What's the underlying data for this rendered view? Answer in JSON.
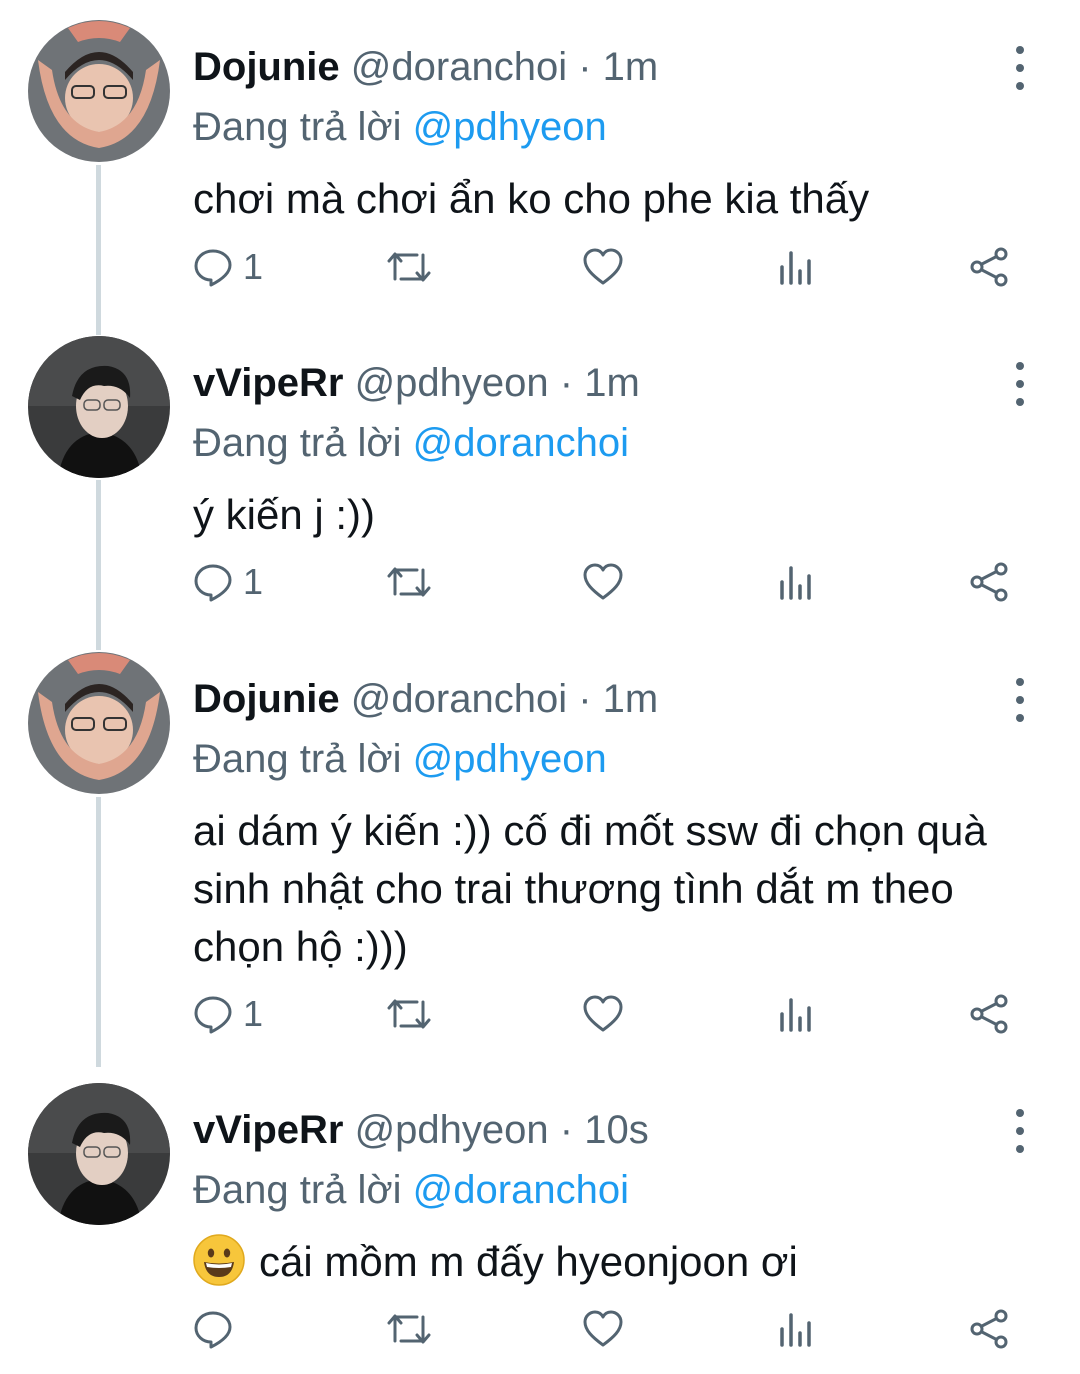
{
  "reply_prefix": "Đang trả lời",
  "dot": "·",
  "tweets": [
    {
      "name": "Dojunie",
      "handle": "@doranchoi",
      "time": "1m",
      "reply_to": "@pdhyeon",
      "text": "chơi mà chơi ẩn ko cho phe kia thấy",
      "reply_count": "1"
    },
    {
      "name": "vVipeRr",
      "handle": "@pdhyeon",
      "time": "1m",
      "reply_to": "@doranchoi",
      "text": "ý kiến j :))",
      "reply_count": "1"
    },
    {
      "name": "Dojunie",
      "handle": "@doranchoi",
      "time": "1m",
      "reply_to": "@pdhyeon",
      "text": "ai dám ý kiến :)) cố đi mốt ssw đi chọn quà sinh nhật cho trai thương tình dắt m theo chọn hộ :)))",
      "reply_count": "1"
    },
    {
      "name": "vVipeRr",
      "handle": "@pdhyeon",
      "time": "10s",
      "reply_to": "@doranchoi",
      "text": "cái mồm m đấy hyeonjoon ơi",
      "emoji": "grinning-face-emoji",
      "reply_count": ""
    }
  ],
  "icons": {
    "reply": "reply-icon",
    "retweet": "retweet-icon",
    "like": "like-icon",
    "analytics": "analytics-icon",
    "share": "share-icon",
    "more": "more-vertical-icon"
  },
  "colors": {
    "text": "#0f1419",
    "secondary": "#536471",
    "mention": "#1d9bf0",
    "thread_line": "#cfd9de"
  }
}
